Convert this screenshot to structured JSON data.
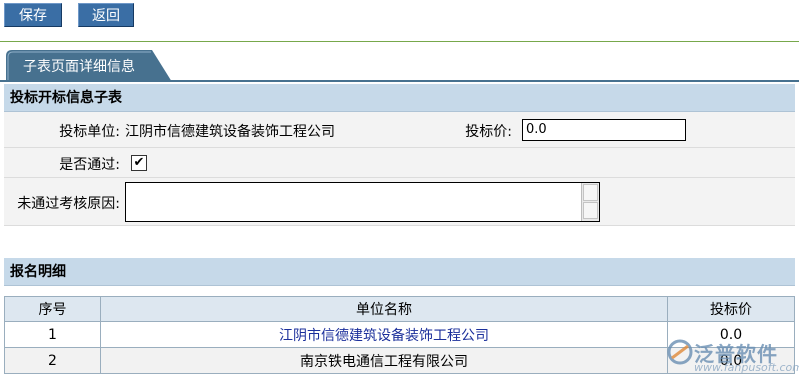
{
  "toolbar": {
    "save_label": "保存",
    "back_label": "返回"
  },
  "tab": {
    "label": "子表页面详细信息"
  },
  "bid_section": {
    "title": "投标开标信息子表",
    "bid_unit_label": "投标单位:",
    "bid_unit_value": "江阴市信德建筑设备装饰工程公司",
    "bid_price_label": "投标价:",
    "bid_price_value": "0.0",
    "passed_label": "是否通过:",
    "passed_check": "✔",
    "reason_label": "未通过考核原因:",
    "reason_value": ""
  },
  "signup_section": {
    "title": "报名明细",
    "columns": [
      "序号",
      "单位名称",
      "投标价"
    ],
    "rows": [
      {
        "no": "1",
        "unit": "江阴市信德建筑设备装饰工程公司",
        "price": "0.0"
      },
      {
        "no": "2",
        "unit": "南京铁电通信工程有限公司",
        "price": "0.0"
      }
    ]
  },
  "watermark": {
    "brand": "泛普软件",
    "url": "www.fanpusoft.com"
  },
  "colors": {
    "button_bg": "#3a6ea5",
    "tab_bg": "#47718f",
    "section_head_bg": "#c6d9e9",
    "link": "#1b2f9b"
  }
}
